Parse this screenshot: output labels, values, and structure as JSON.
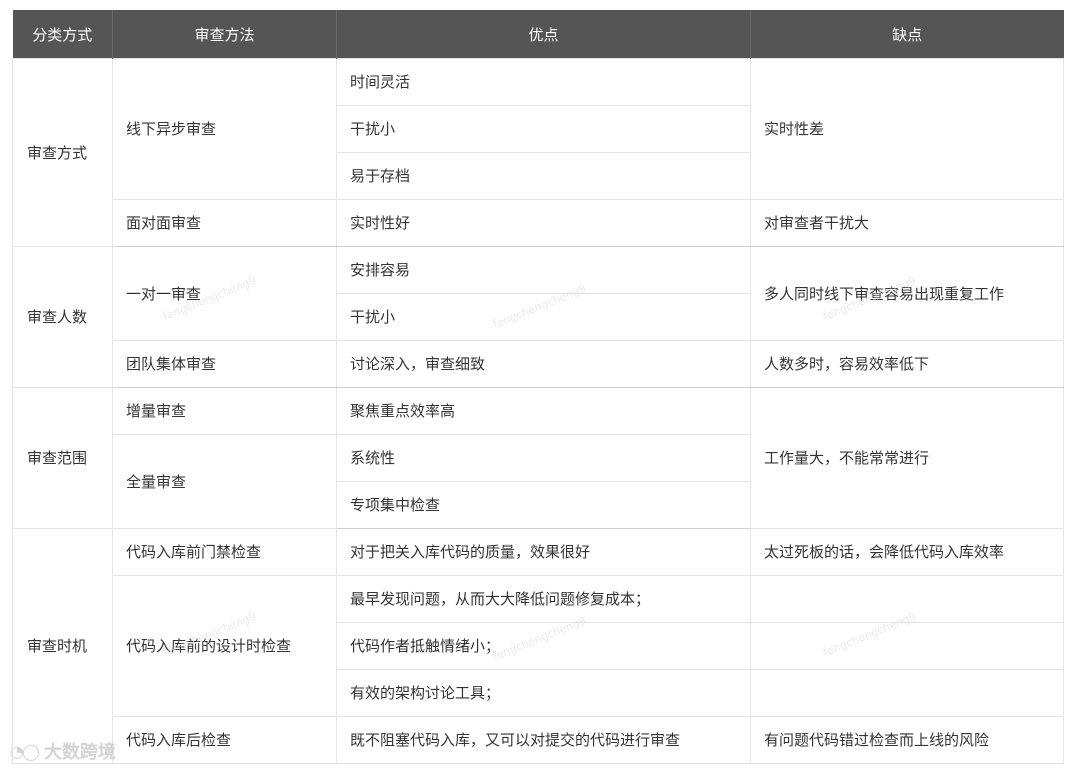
{
  "headers": [
    "分类方式",
    "审查方法",
    "优点",
    "缺点"
  ],
  "rows": {
    "way": {
      "category": "审查方式",
      "offline": {
        "method": "线下异步审查",
        "pros": [
          "时间灵活",
          "干扰小",
          "易于存档"
        ],
        "cons": "实时性差"
      },
      "f2f": {
        "method": "面对面审查",
        "pros": "实时性好",
        "cons": "对审查者干扰大"
      }
    },
    "people": {
      "category": "审查人数",
      "one": {
        "method": "一对一审查",
        "pros": [
          "安排容易",
          "干扰小"
        ],
        "cons": "多人同时线下审查容易出现重复工作"
      },
      "team": {
        "method": "团队集体审查",
        "pros": "讨论深入，审查细致",
        "cons": "人数多时，容易效率低下"
      }
    },
    "scope": {
      "category": "审查范围",
      "incr": {
        "method": "增量审查",
        "pros": "聚焦重点效率高"
      },
      "full": {
        "method": "全量审查",
        "pros": [
          "系统性",
          "专项集中检查"
        ]
      },
      "cons": "工作量大，不能常常进行"
    },
    "timing": {
      "category": "审查时机",
      "gate": {
        "method": "代码入库前门禁检查",
        "pros": "对于把关入库代码的质量，效果很好",
        "cons": "太过死板的话，会降低代码入库效率"
      },
      "design": {
        "method": "代码入库前的设计时检查",
        "pros": [
          "最早发现问题，从而大大降低问题修复成本；",
          "代码作者抵触情绪小；",
          "有效的架构讨论工具；"
        ],
        "cons": [
          "",
          "",
          ""
        ]
      },
      "post": {
        "method": "代码入库后检查",
        "pros": "既不阻塞代码入库，又可以对提交的代码进行审查",
        "cons": "有问题代码错过检查而上线的风险"
      }
    }
  },
  "watermark": "fengchengcheng9",
  "logo": "大数跨境"
}
